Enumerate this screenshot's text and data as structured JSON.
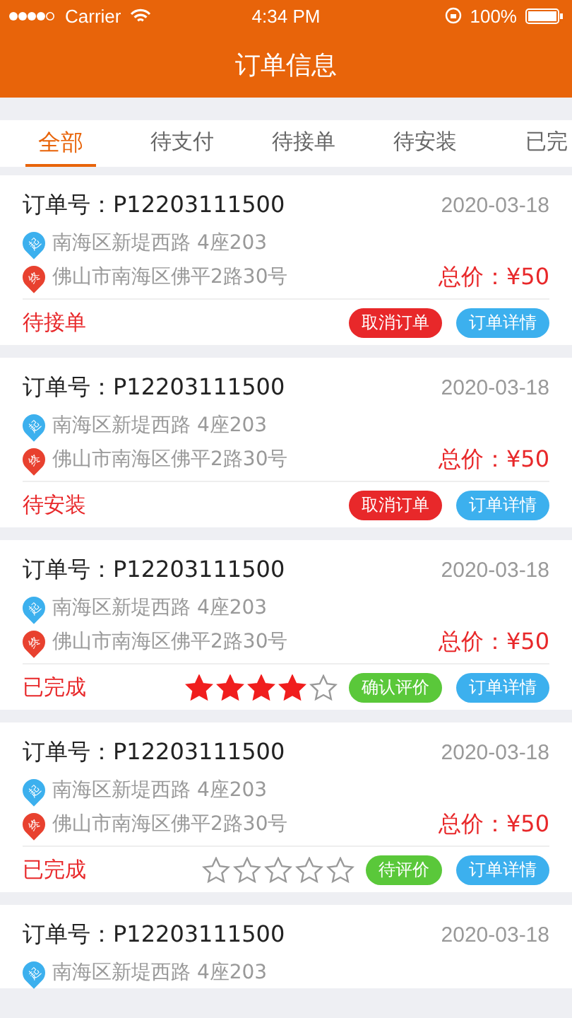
{
  "status_bar": {
    "carrier": "Carrier",
    "time": "4:34 PM",
    "battery": "100%"
  },
  "header": {
    "title": "订单信息"
  },
  "tabs": [
    {
      "label": "全部",
      "selected": true
    },
    {
      "label": "待支付",
      "selected": false
    },
    {
      "label": "待接单",
      "selected": false
    },
    {
      "label": "待安装",
      "selected": false
    },
    {
      "label": "已完",
      "selected": false
    }
  ],
  "orders": [
    {
      "order_no": "订单号：P12203111500",
      "date": "2020-03-18",
      "start_pin": "起",
      "start": "南海区新堤西路 4座203",
      "end_pin": "终",
      "end": "佛山市南海区佛平2路30号",
      "price": "总价：¥50",
      "status": "待接单",
      "buttons": [
        {
          "kind": "cancel",
          "label": "取消订单"
        },
        {
          "kind": "details",
          "label": "订单详情"
        }
      ]
    },
    {
      "order_no": "订单号：P12203111500",
      "date": "2020-03-18",
      "start_pin": "起",
      "start": "南海区新堤西路 4座203",
      "end_pin": "终",
      "end": "佛山市南海区佛平2路30号",
      "price": "总价：¥50",
      "status": "待安装",
      "buttons": [
        {
          "kind": "cancel",
          "label": "取消订单"
        },
        {
          "kind": "details",
          "label": "订单详情"
        }
      ]
    },
    {
      "order_no": "订单号：P12203111500",
      "date": "2020-03-18",
      "start_pin": "起",
      "start": "南海区新堤西路 4座203",
      "end_pin": "终",
      "end": "佛山市南海区佛平2路30号",
      "price": "总价：¥50",
      "status": "已完成",
      "stars": 4,
      "buttons": [
        {
          "kind": "review",
          "label": "确认评价"
        },
        {
          "kind": "details",
          "label": "订单详情"
        }
      ]
    },
    {
      "order_no": "订单号：P12203111500",
      "date": "2020-03-18",
      "start_pin": "起",
      "start": "南海区新堤西路 4座203",
      "end_pin": "终",
      "end": "佛山市南海区佛平2路30号",
      "price": "总价：¥50",
      "status": "已完成",
      "stars": 0,
      "buttons": [
        {
          "kind": "review",
          "label": "待评价"
        },
        {
          "kind": "details",
          "label": "订单详情"
        }
      ]
    },
    {
      "order_no": "订单号：P12203111500",
      "date": "2020-03-18",
      "start_pin": "起",
      "start": "南海区新堤西路 4座203"
    }
  ]
}
